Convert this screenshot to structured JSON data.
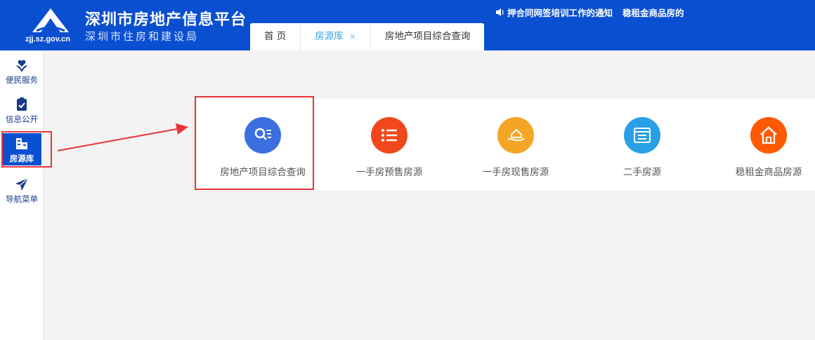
{
  "header": {
    "logo_text": "zjj.sz.gov.cn",
    "title": "深圳市房地产信息平台",
    "subtitle": "深圳市住房和建设局",
    "notices": [
      "押合同网签培训工作的通知",
      "稳租金商品房的"
    ],
    "notice_icon": "speaker-icon"
  },
  "tabs": [
    {
      "label": "首 页"
    },
    {
      "label": "房源库",
      "close": "×",
      "active": true
    },
    {
      "label": "房地产项目综合查询"
    }
  ],
  "sidebar": {
    "items": [
      {
        "label": "便民服务",
        "icon": "heart-hand-icon"
      },
      {
        "label": "信息公开",
        "icon": "clipboard-check-icon"
      },
      {
        "label": "房源库",
        "icon": "building-icon",
        "active": true
      },
      {
        "label": "导航菜单",
        "icon": "paper-plane-icon"
      }
    ]
  },
  "cards": [
    {
      "label": "房地产项目综合查询",
      "icon": "search-list-icon",
      "color": "#3b6fe0"
    },
    {
      "label": "一手房预售房源",
      "icon": "list-icon",
      "color": "#f0481c"
    },
    {
      "label": "一手房现售房源",
      "icon": "hand-house-icon",
      "color": "#f5a524"
    },
    {
      "label": "二手房源",
      "icon": "document-list-icon",
      "color": "#29a0e6"
    },
    {
      "label": "稳租金商品房源",
      "icon": "house-icon",
      "color": "#ff5a00"
    }
  ],
  "colors": {
    "brand": "#0b4fd1",
    "highlight": "#e8343a",
    "tab_active": "#3aa0e6"
  }
}
